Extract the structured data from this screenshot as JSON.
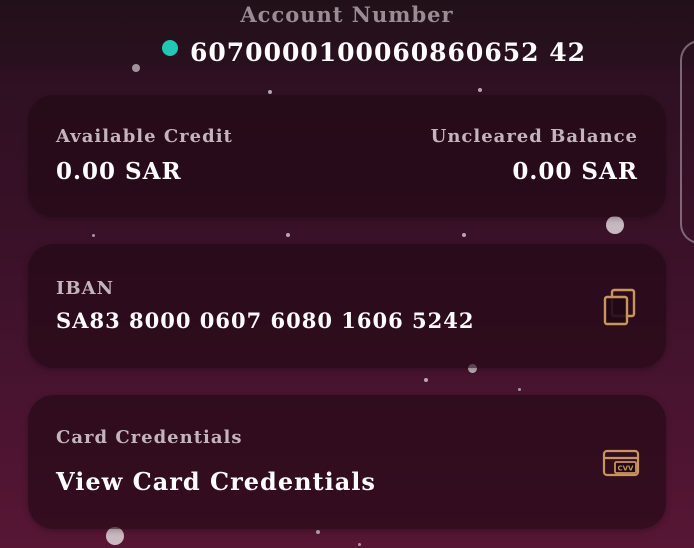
{
  "account": {
    "label": "Account Number",
    "number": "6070000100060860652 42",
    "status_color": "#1fc8b4"
  },
  "balances": {
    "available_label": "Available Credit",
    "available_value": "0.00 SAR",
    "uncleared_label": "Uncleared Balance",
    "uncleared_value": "0.00 SAR"
  },
  "iban": {
    "label": "IBAN",
    "value": "SA83 8000 0607 6080 1606 5242",
    "icon": "copy-icon"
  },
  "card_credentials": {
    "label": "Card Credentials",
    "action": "View Card Credentials",
    "icon": "card-cvv-icon",
    "icon_text": "CVV"
  },
  "colors": {
    "accent_gold": "#c8955a",
    "status_teal": "#1fc8b4"
  }
}
